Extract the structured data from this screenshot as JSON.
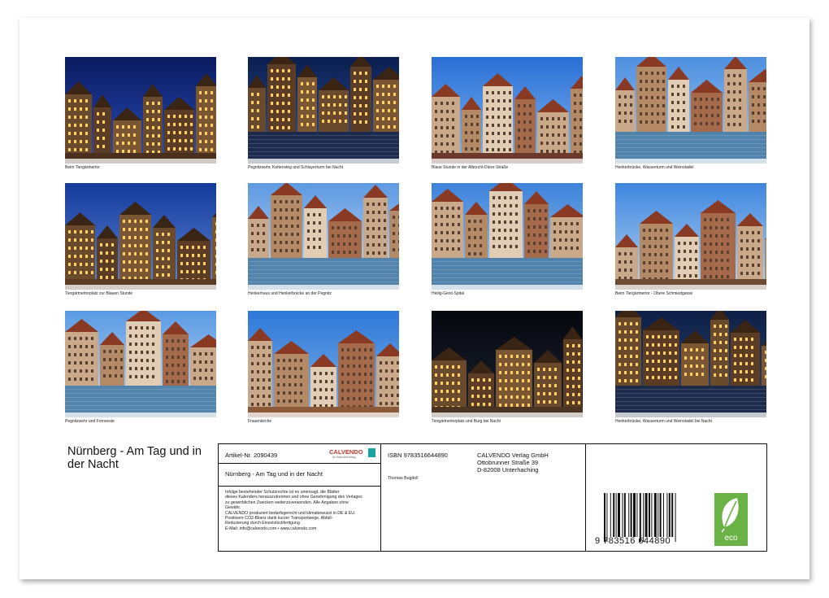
{
  "document": {
    "title": "Nürnberg - Am Tag und in der Nacht"
  },
  "photos": [
    {
      "caption": "Beim Tiergärtnertor"
    },
    {
      "caption": "Pegnitzwehr, Kettensteg und Schlayerturm bei Nacht"
    },
    {
      "caption": "Blaue Stunde in der Albrecht-Dürer-Straße"
    },
    {
      "caption": "Henkerbrücke, Wasserturm und Weinstadel"
    },
    {
      "caption": "Tiergärtnertorplatz zur Blauen Stunde"
    },
    {
      "caption": "Henkerhaus und Henkerbrücke an der Pegnitz"
    },
    {
      "caption": "Heilig-Geist-Spital"
    },
    {
      "caption": "Beim Tiergärtnertor - Obere Schmiedgasse"
    },
    {
      "caption": "Pegnitzwehr und Fronveste"
    },
    {
      "caption": "Frauenkirche"
    },
    {
      "caption": "Tiergärtnertorplatz und Burg bei Nacht"
    },
    {
      "caption": "Henkerbrücke, Wasserturm und Weinstadel bei Nacht"
    }
  ],
  "info": {
    "article_no": "Artikel-Nr. 2090439",
    "logo": "CALVENDO",
    "logo_sub": "Ihr Kalenderverlag",
    "product_title": "Nürnberg - Am Tag und in der Nacht",
    "legal_lines": [
      "Infolge bestehender Schutzrechte ist es untersagt, die Blätter",
      "dieses Kalenders herauszutrennen und ohne Genehmigung des Verlages",
      "zu gewerblichen Zwecken weiterzuverwenden. Alle Angaben ohne",
      "Gewähr.",
      "CALVENDO produziert bedarfsgerecht und klimabewusst in DE & EU.",
      "Positivere CO2-Bilanz dank kurzer Transportwege. Abfall-",
      "Reduzierung durch Einzelstückfertigung.",
      "E-Mail: info@calvendo.com • www.calvendo.com"
    ],
    "isbn": "ISBN 9783516644890",
    "author": "Thomas Bugdoll",
    "publisher_lines": [
      "CALVENDO Verlag GmbH",
      "Ottobrunner Straße 39",
      "D-82008 Unterhaching"
    ],
    "barcode_digits": "9 783516 644890",
    "eco_label": "eco"
  },
  "colors": {
    "night_sky": "#0d1d5c",
    "day_sky": "#3f86d8",
    "eco_green": "#6ab245"
  }
}
